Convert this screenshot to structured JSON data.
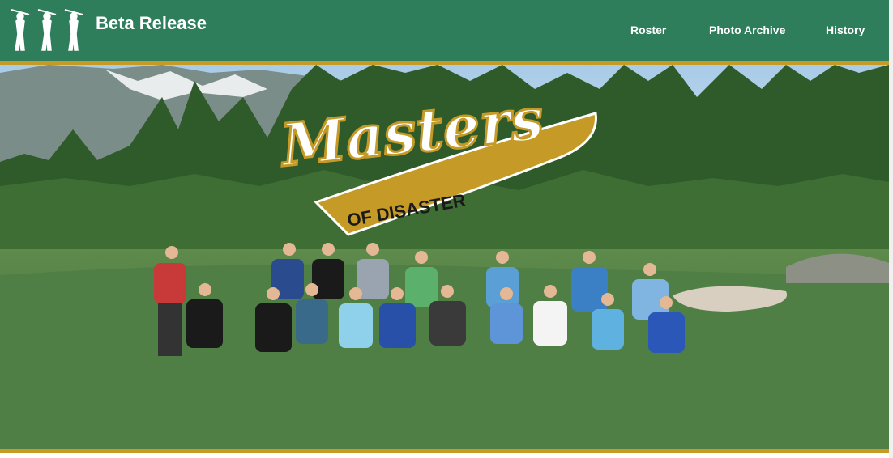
{
  "app": {
    "brand_name": "Beta Release"
  },
  "nav": {
    "items": [
      {
        "label": "Roster"
      },
      {
        "label": "Photo Archive"
      },
      {
        "label": "History"
      }
    ]
  },
  "hero": {
    "logo_word": "Masters",
    "logo_banner": "OF DISASTER"
  },
  "colors": {
    "nav_bg": "#2e7d5b",
    "accent_gold": "#c69a27"
  },
  "icons": {
    "brand_logo": "golfer-trio-icon"
  }
}
